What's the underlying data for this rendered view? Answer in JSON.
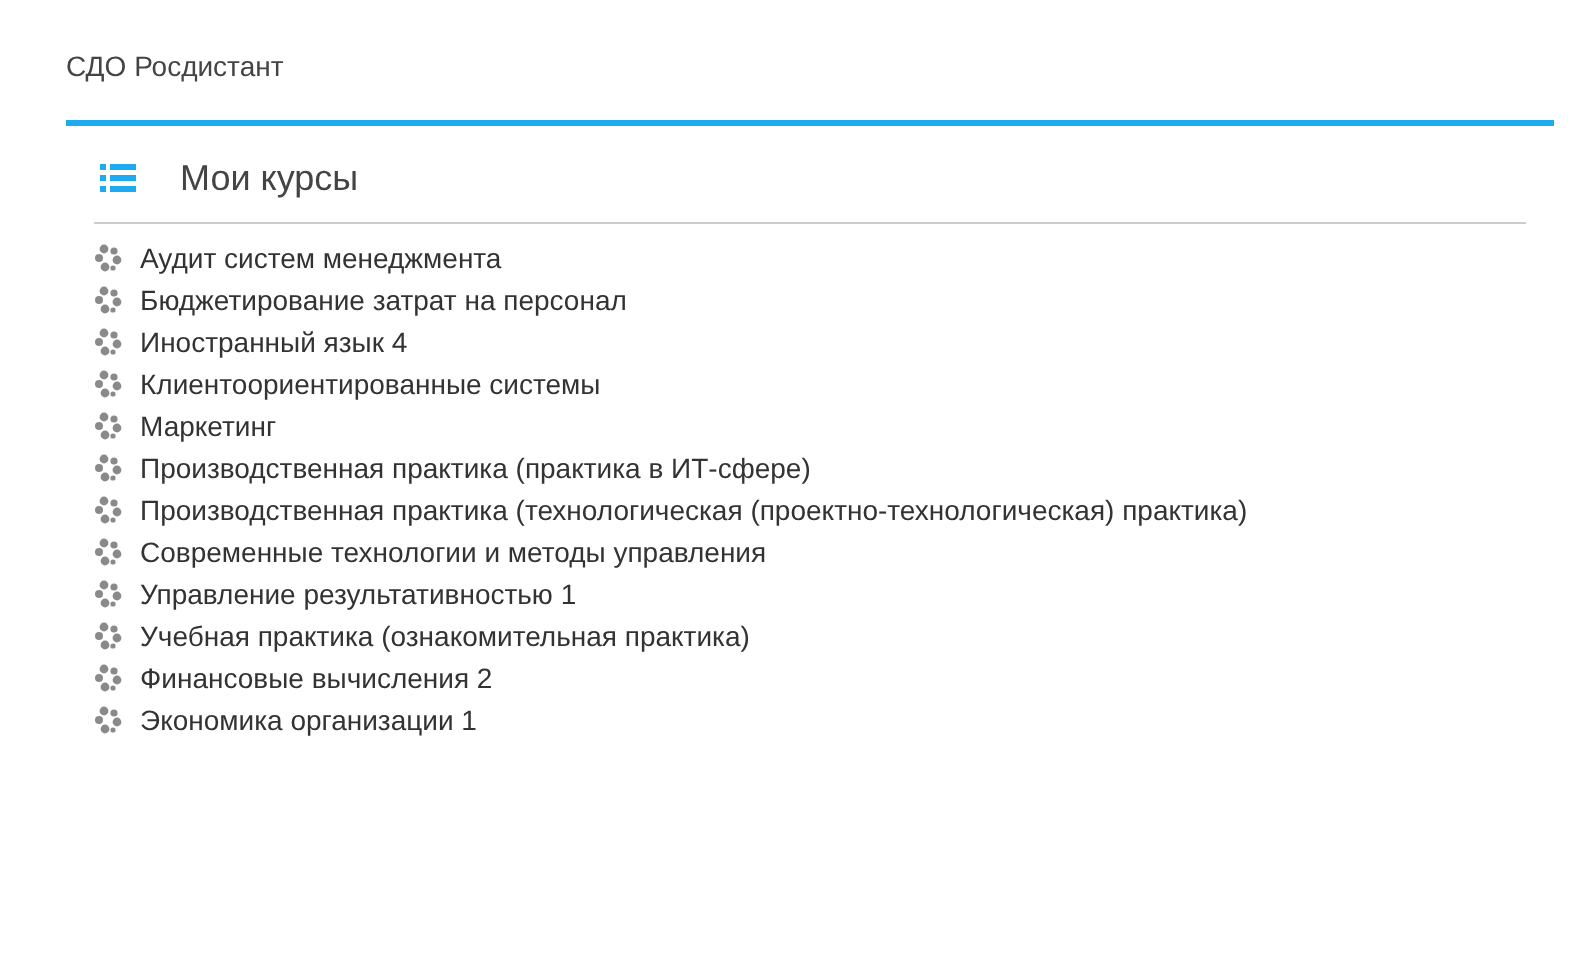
{
  "site_title": "СДО Росдистант",
  "block": {
    "title": "Мои курсы",
    "courses": [
      "Аудит систем менеджмента",
      "Бюджетирование затрат на персонал",
      "Иностранный язык 4",
      "Клиентоориентированные системы",
      "Маркетинг",
      "Производственная практика (практика в ИТ-сфере)",
      "Производственная практика (технологическая (проектно-технологическая) практика)",
      "Современные технологии и методы управления",
      "Управление результативностью 1",
      "Учебная практика (ознакомительная практика)",
      "Финансовые вычисления 2",
      "Экономика организации 1"
    ]
  }
}
